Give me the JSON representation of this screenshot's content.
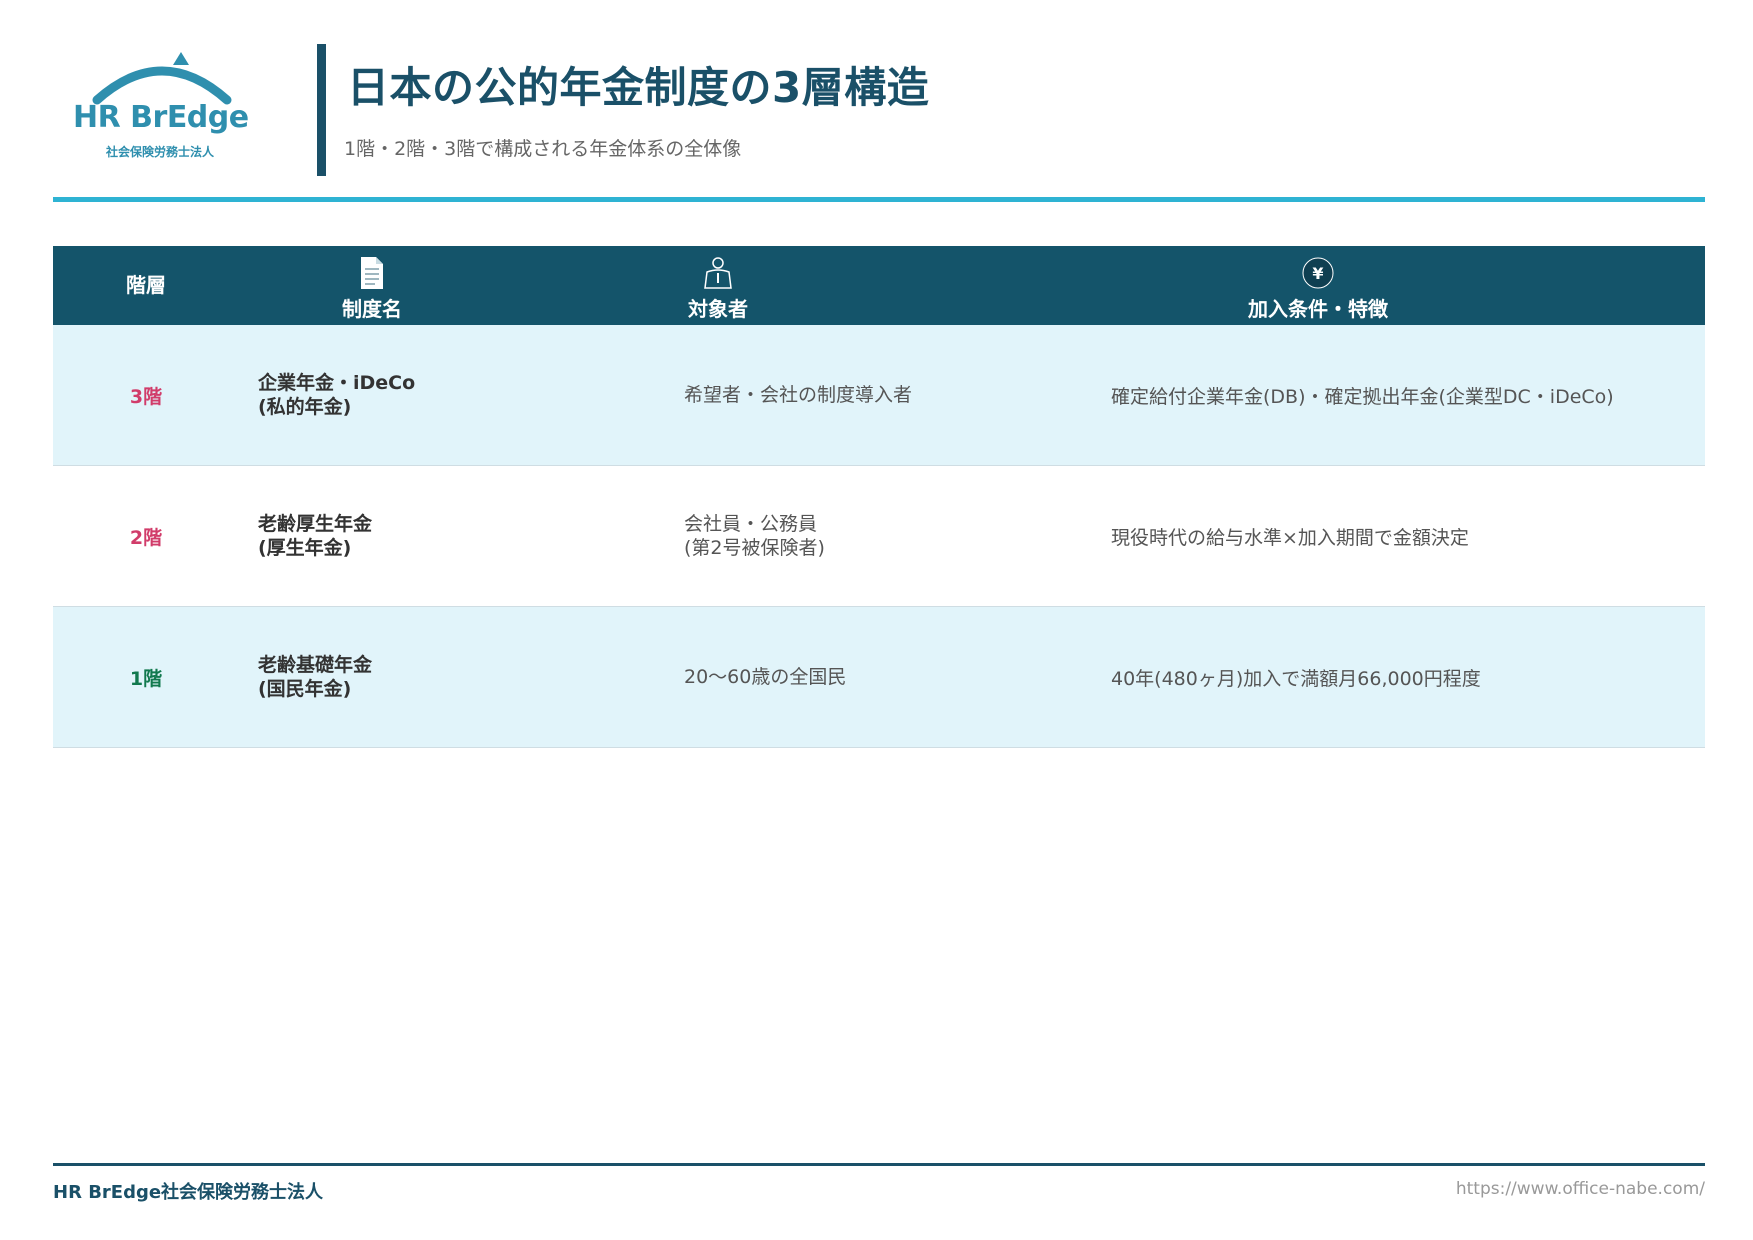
{
  "logo": {
    "name": "HR BrEdge",
    "sub": "社会保険労務士法人"
  },
  "title": "日本の公的年金制度の3層構造",
  "subtitle": "1階・2階・3階で構成される年金体系の全体像",
  "table": {
    "headers": {
      "layer": "階層",
      "name": "制度名",
      "target": "対象者",
      "feature": "加入条件・特徴"
    },
    "header_icons": [
      "document-icon",
      "person-icon",
      "yen-icon"
    ],
    "rows": [
      {
        "layer": "3階",
        "name_line1": "企業年金・iDeCo",
        "name_line2": "(私的年金)",
        "target_line1": "希望者・会社の制度導入者",
        "target_line2": "",
        "feature": "確定給付企業年金(DB)・確定拠出年金(企業型DC・iDeCo)"
      },
      {
        "layer": "2階",
        "name_line1": "老齢厚生年金",
        "name_line2": "(厚生年金)",
        "target_line1": "会社員・公務員",
        "target_line2": "(第2号被保険者)",
        "feature": "現役時代の給与水準×加入期間で金額決定"
      },
      {
        "layer": "1階",
        "name_line1": "老齢基礎年金",
        "name_line2": "(国民年金)",
        "target_line1": "20〜60歳の全国民",
        "target_line2": "",
        "feature": "40年(480ヶ月)加入で満額月66,000円程度"
      }
    ]
  },
  "colors": {
    "primary": "#1a5068",
    "accent": "#2eb3d3",
    "layer_red": "#d13c6a",
    "layer_green": "#11794e",
    "row_alt": "#e1f4fa"
  },
  "footer": {
    "org": "HR BrEdge社会保険労務士法人",
    "url": "https://www.office-nabe.com/"
  }
}
